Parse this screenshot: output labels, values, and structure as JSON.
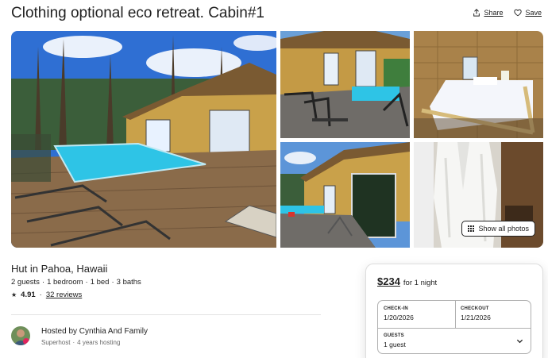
{
  "listing": {
    "title": "Clothing optional eco retreat. Cabin#1",
    "share_label": "Share",
    "save_label": "Save",
    "show_all_photos_label": "Show all photos",
    "subtitle": "Hut in Pahoa, Hawaii",
    "details": [
      "2 guests",
      "·",
      "1 bedroom",
      "·",
      "1 bed",
      "·",
      "3 baths"
    ],
    "rating": {
      "star": "★",
      "score": "4.91",
      "separator": "·",
      "reviews": "32 reviews"
    },
    "host": {
      "name": "Hosted by Cynthia And Family",
      "badge": "Superhost",
      "separator": "·",
      "years": "4 years hosting"
    }
  },
  "booking": {
    "price": "$234",
    "per_night": "for 1 night",
    "checkin_label": "CHECK-IN",
    "checkin_value": "1/20/2026",
    "checkout_label": "CHECKOUT",
    "checkout_value": "1/21/2026",
    "guests_label": "GUESTS",
    "guests_value": "1 guest"
  },
  "icons": [
    "share-icon",
    "heart-icon",
    "grid-icon",
    "star-icon",
    "chevron-down-icon"
  ],
  "colors": {
    "text": "#222222",
    "muted": "#6a6a6a",
    "border": "#dddddd",
    "pool": "#2ec4e6",
    "wood": "#8a6b4a"
  }
}
